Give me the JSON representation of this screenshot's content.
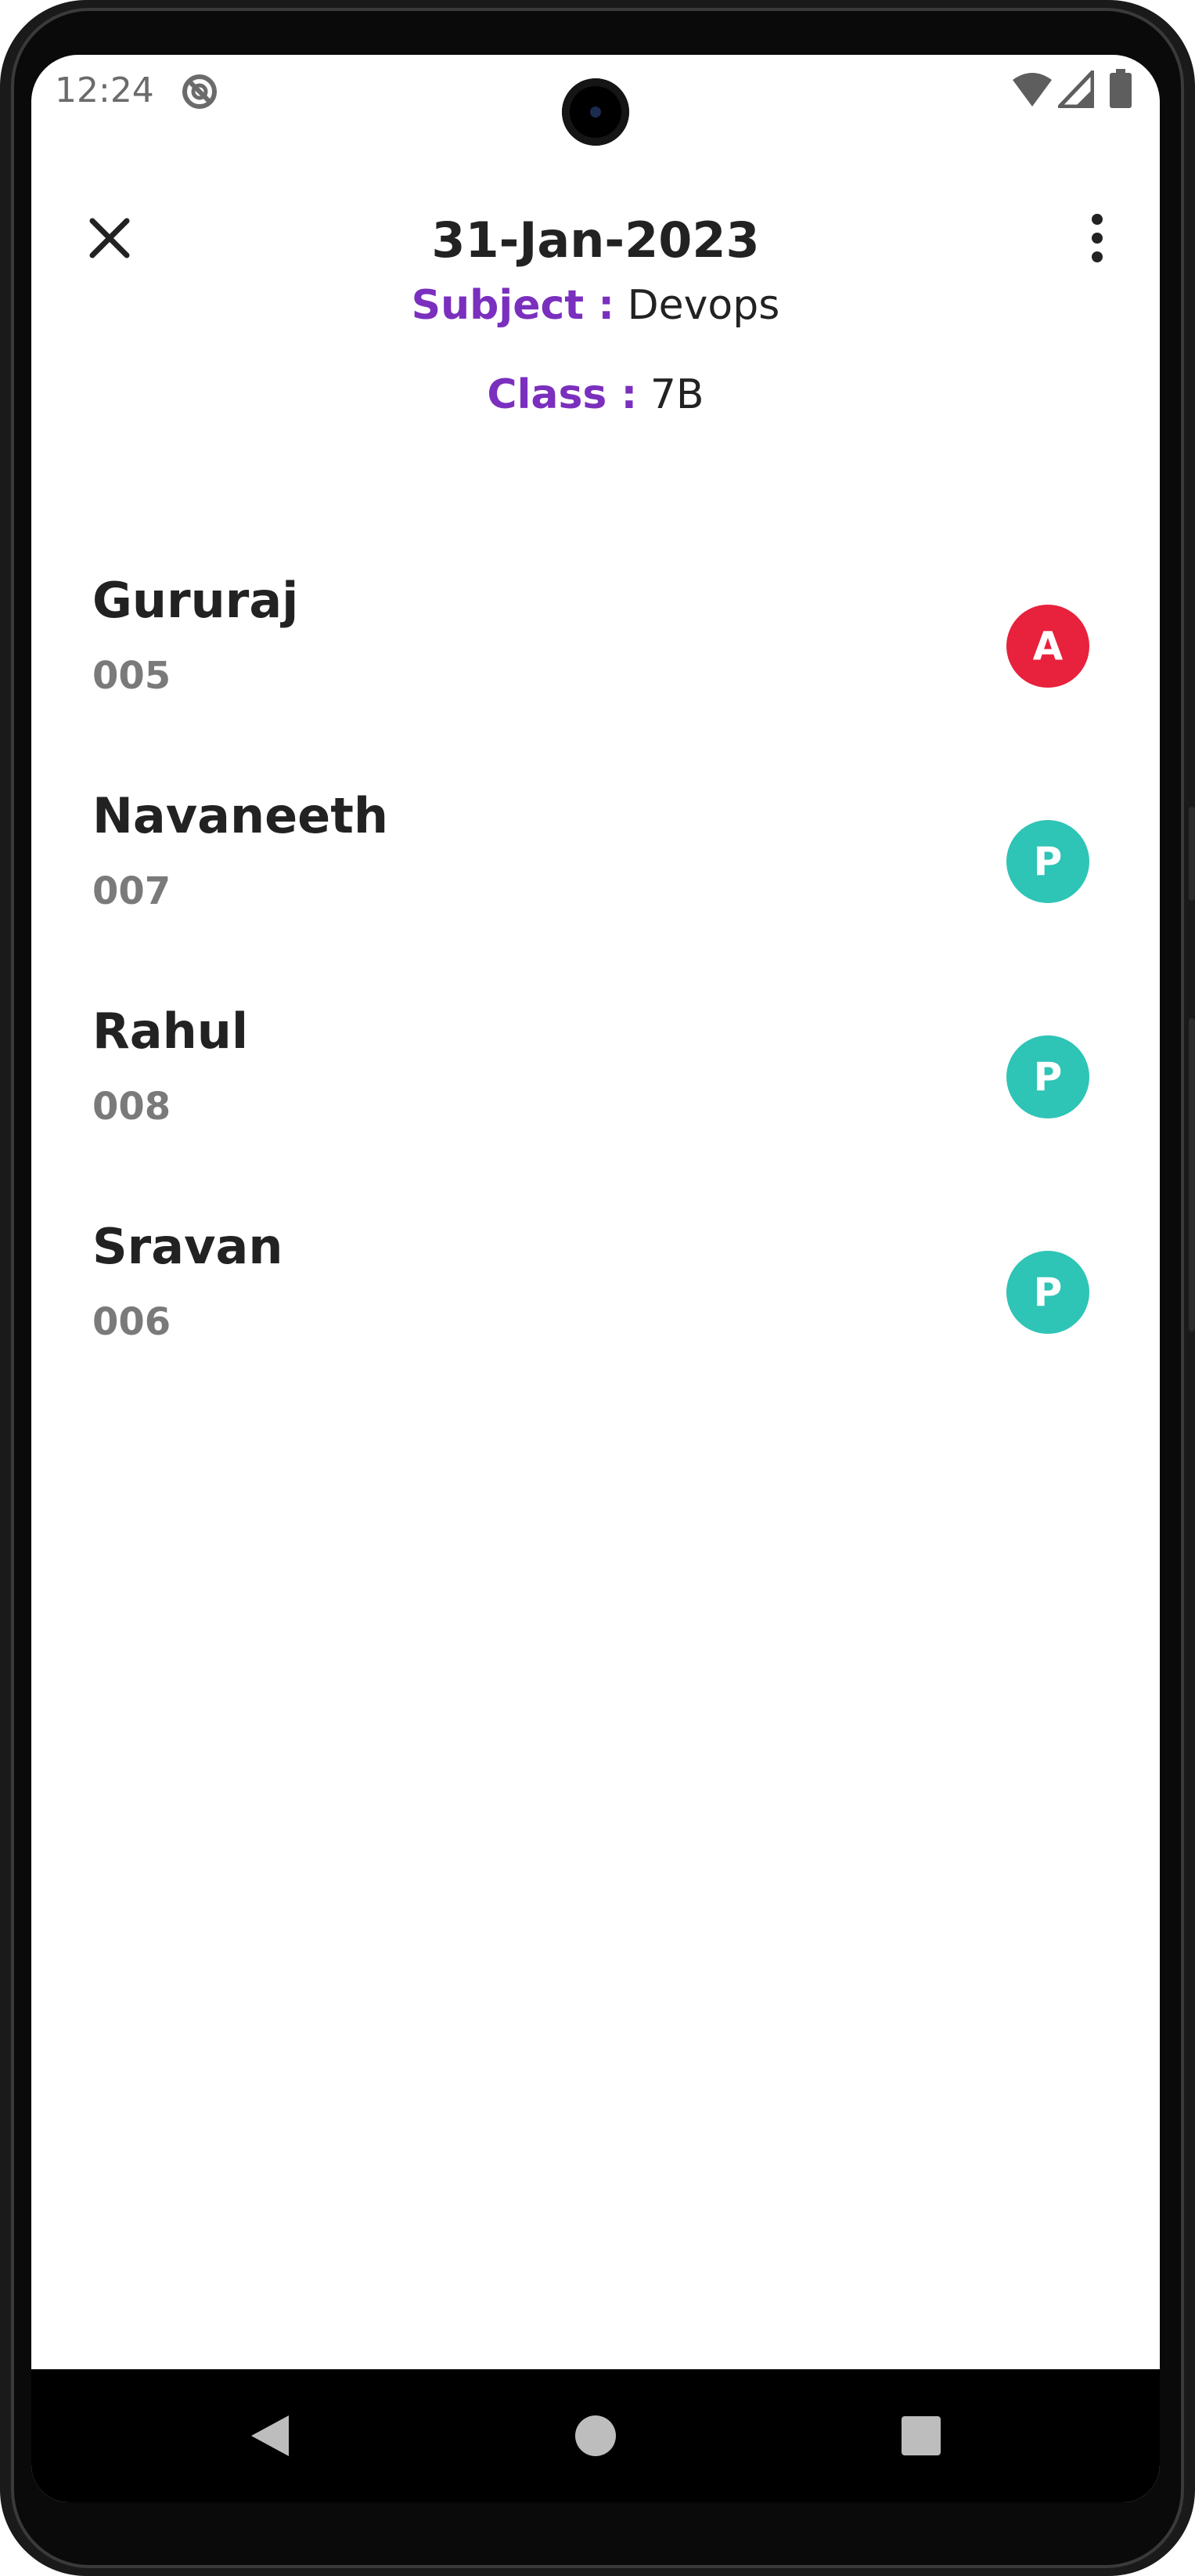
{
  "status_bar": {
    "time": "12:24",
    "icons": [
      "no-disturb-icon",
      "wifi-icon",
      "signal-icon",
      "battery-icon"
    ]
  },
  "app_bar": {
    "title": "31-Jan-2023",
    "close_icon": "close-icon",
    "more_icon": "more-vertical-icon"
  },
  "meta": {
    "subject_label": "Subject :",
    "subject_value": "Devops",
    "class_label": "Class :",
    "class_value": "7B"
  },
  "students": [
    {
      "name": "Gururaj",
      "id": "005",
      "status": "A",
      "status_color": "#e8213c"
    },
    {
      "name": "Navaneeth",
      "id": "007",
      "status": "P",
      "status_color": "#2ec4b6"
    },
    {
      "name": "Rahul",
      "id": "008",
      "status": "P",
      "status_color": "#2ec4b6"
    },
    {
      "name": "Sravan",
      "id": "006",
      "status": "P",
      "status_color": "#2ec4b6"
    }
  ],
  "nav": {
    "back_icon": "back-triangle-icon",
    "home_icon": "home-circle-icon",
    "recents_icon": "recents-square-icon"
  },
  "colors": {
    "accent": "#7a2fbe",
    "absent": "#e8213c",
    "present": "#2ec4b6"
  }
}
